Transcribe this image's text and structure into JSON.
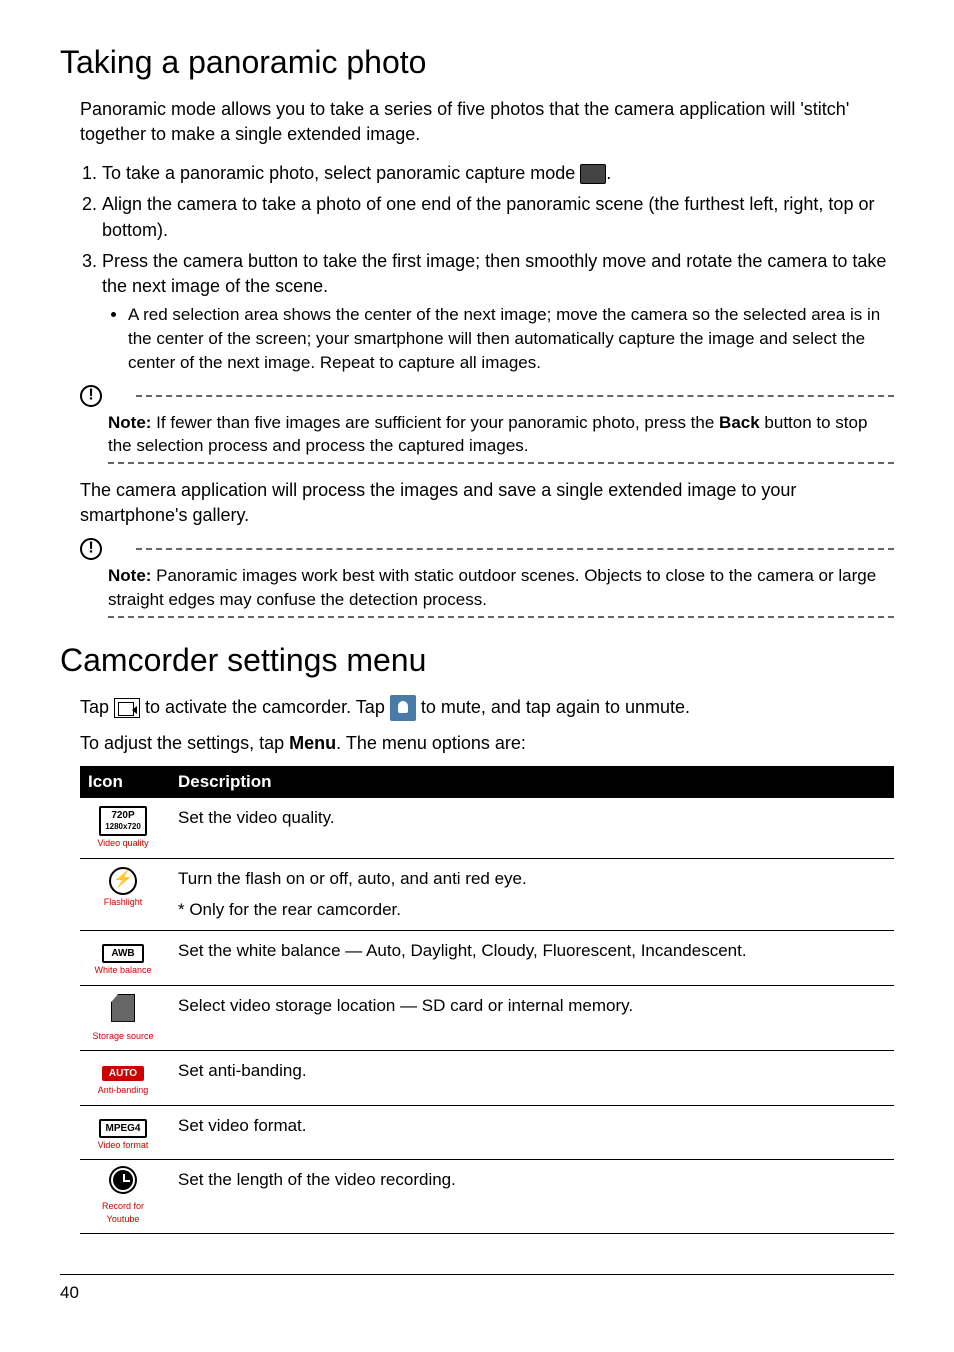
{
  "section1": {
    "heading": "Taking a panoramic photo",
    "intro": "Panoramic mode allows you to take a series of five photos that the camera application will 'stitch' together to make a single extended image.",
    "steps": {
      "s1a": "To take a panoramic photo, select panoramic capture mode ",
      "s1b": ".",
      "s2": "Align the camera to take a photo of one end of the panoramic scene (the furthest left, right, top or bottom).",
      "s3": "Press the camera button to take the first image; then smoothly move and rotate the camera to take the next image of the scene.",
      "s3_bullet": "A red selection area shows the center of the next image; move the camera so the selected area is in the center of the screen; your smartphone will then automatically capture the image and select the center of the next image. Repeat to capture all images."
    },
    "note1_label": "Note:",
    "note1_a": " If fewer than five images are sufficient for your panoramic photo, press the ",
    "note1_back": "Back",
    "note1_b": " button to stop the selection process and process the captured images.",
    "para_after": "The camera application will process the images and save a single extended image to your smartphone's gallery.",
    "note2_label": "Note:",
    "note2": " Panoramic images work best with static outdoor scenes. Objects to close to the camera or large straight edges may confuse the detection process."
  },
  "section2": {
    "heading": "Camcorder settings menu",
    "line1a": "Tap ",
    "line1b": " to activate the camcorder. Tap ",
    "line1c": " to mute, and tap again to unmute.",
    "line2a": "To adjust the settings, tap ",
    "line2_menu": "Menu",
    "line2b": ". The menu options are:",
    "table": {
      "header_icon": "Icon",
      "header_desc": "Description",
      "rows": [
        {
          "badge_line1": "720P",
          "badge_line2": "1280x720",
          "caption": "Video quality",
          "desc": "Set the video quality."
        },
        {
          "caption": "Flashlight",
          "desc": "Turn the flash on or off, auto, and anti red eye.",
          "desc2": "* Only for the rear camcorder."
        },
        {
          "badge_line1": "AWB",
          "caption": "White balance",
          "desc": "Set the white balance — Auto, Daylight, Cloudy, Fluorescent, Incandescent."
        },
        {
          "caption": "Storage source",
          "desc": "Select video storage location — SD card or internal memory."
        },
        {
          "badge_line1": "AUTO",
          "caption": "Anti-banding",
          "desc": "Set anti-banding."
        },
        {
          "badge_line1": "MPEG4",
          "caption": "Video format",
          "desc": "Set video format."
        },
        {
          "caption": "Record for Youtube",
          "desc": "Set the length of the video recording."
        }
      ]
    }
  },
  "page_number": "40"
}
